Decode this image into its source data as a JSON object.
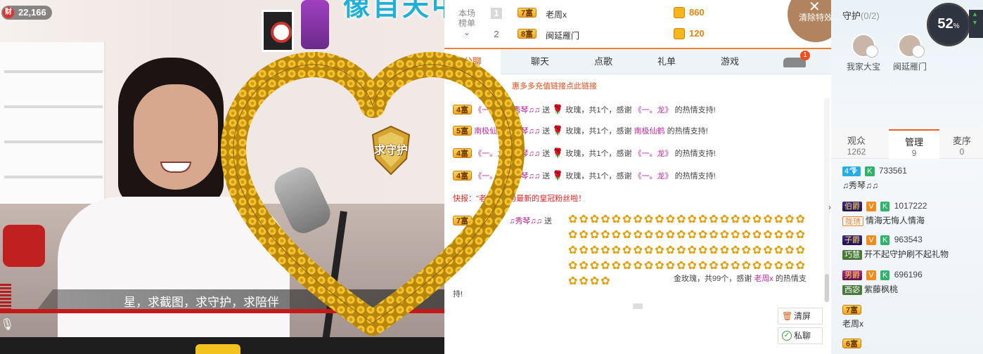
{
  "video": {
    "viewer_count": "22,166",
    "viewer_icon": "wealth-icon",
    "banner_text": "像自天中僅後的点",
    "subtitle": "星，求截图，求守护，求陪伴",
    "mic_icon": "microphone-icon"
  },
  "rank": {
    "label_line1": "本场",
    "label_line2": "榜单",
    "rows": [
      {
        "num": "1",
        "badge": "7富",
        "name": "老周x",
        "value": "860"
      },
      {
        "num": "2",
        "badge": "8富",
        "name": "闽延雁门",
        "value": "120"
      }
    ]
  },
  "chat_tabs": [
    "公聊",
    "聊天",
    "点歌",
    "礼单",
    "游戏"
  ],
  "car_badge": "1",
  "promo": "惠多多充值链接点此链接",
  "messages": [
    {
      "badge": "4富",
      "from": "《一。龙",
      "to": "♫秀琴♫♫",
      "verb": "送",
      "gift": "玫瑰，共1个，感谢",
      "thank": "《一。龙》",
      "tail": "的热情支持!"
    },
    {
      "badge": "5富",
      "from": "南极仙鹤",
      "to": "♫秀琴♫♫",
      "verb": "送",
      "gift": "玫瑰，共1个，感谢",
      "thank": "南极仙鹤",
      "tail": "的热情支持!"
    },
    {
      "badge": "4富",
      "from": "《一。龙",
      "to": "♫秀琴♫♫",
      "verb": "送",
      "gift": "玫瑰，共1个，感谢",
      "thank": "《一。龙》",
      "tail": "的热情支持!"
    },
    {
      "badge": "4富",
      "from": "《一。龙",
      "to": "♫秀琴♫♫",
      "verb": "送",
      "gift": "玫瑰，共1个，感谢",
      "thank": "《一。龙》",
      "tail": "的热情支持!"
    }
  ],
  "alert": "快报：\"老周x\"成为最新的皇冠粉丝啦！",
  "big_gift": {
    "badge": "7富",
    "to": "♫秀琴♫♫",
    "verb": "送",
    "summary": "金玫瑰，共99个，感谢",
    "thank": "老周x",
    "tail": "的热情支",
    "tail2": "持!"
  },
  "buttons": {
    "clear_screen": "清屏",
    "private_chat": "私聊",
    "clear_effects": "清除特效"
  },
  "overlay": {
    "shield_text": "求守护"
  },
  "guard": {
    "title": "守护",
    "count": "(0/2)",
    "members": [
      {
        "name": "我家大宝"
      },
      {
        "name": "闽延雁门"
      }
    ]
  },
  "perf": {
    "cpu": "52",
    "unit": "%"
  },
  "audience_tabs": [
    {
      "label": "观众",
      "count": "1262"
    },
    {
      "label": "管理",
      "count": "9"
    },
    {
      "label": "麦序",
      "count": "0"
    }
  ],
  "users": [
    {
      "level": "4",
      "id": "733561",
      "name": "♫秀琴♫♫"
    },
    {
      "title": "伯爵",
      "id": "1017222",
      "fan": "陇琇",
      "name": "情海无悔人情海"
    },
    {
      "title": "子爵",
      "id": "963543",
      "fan": "巧慧",
      "name": "开不起守护刷不起礼物"
    },
    {
      "title": "男爵",
      "id": "696196",
      "fan": "西宓",
      "name": "紫藤枫桃"
    },
    {
      "badge": "7富",
      "name": "老周x"
    },
    {
      "badge": "6富"
    }
  ]
}
